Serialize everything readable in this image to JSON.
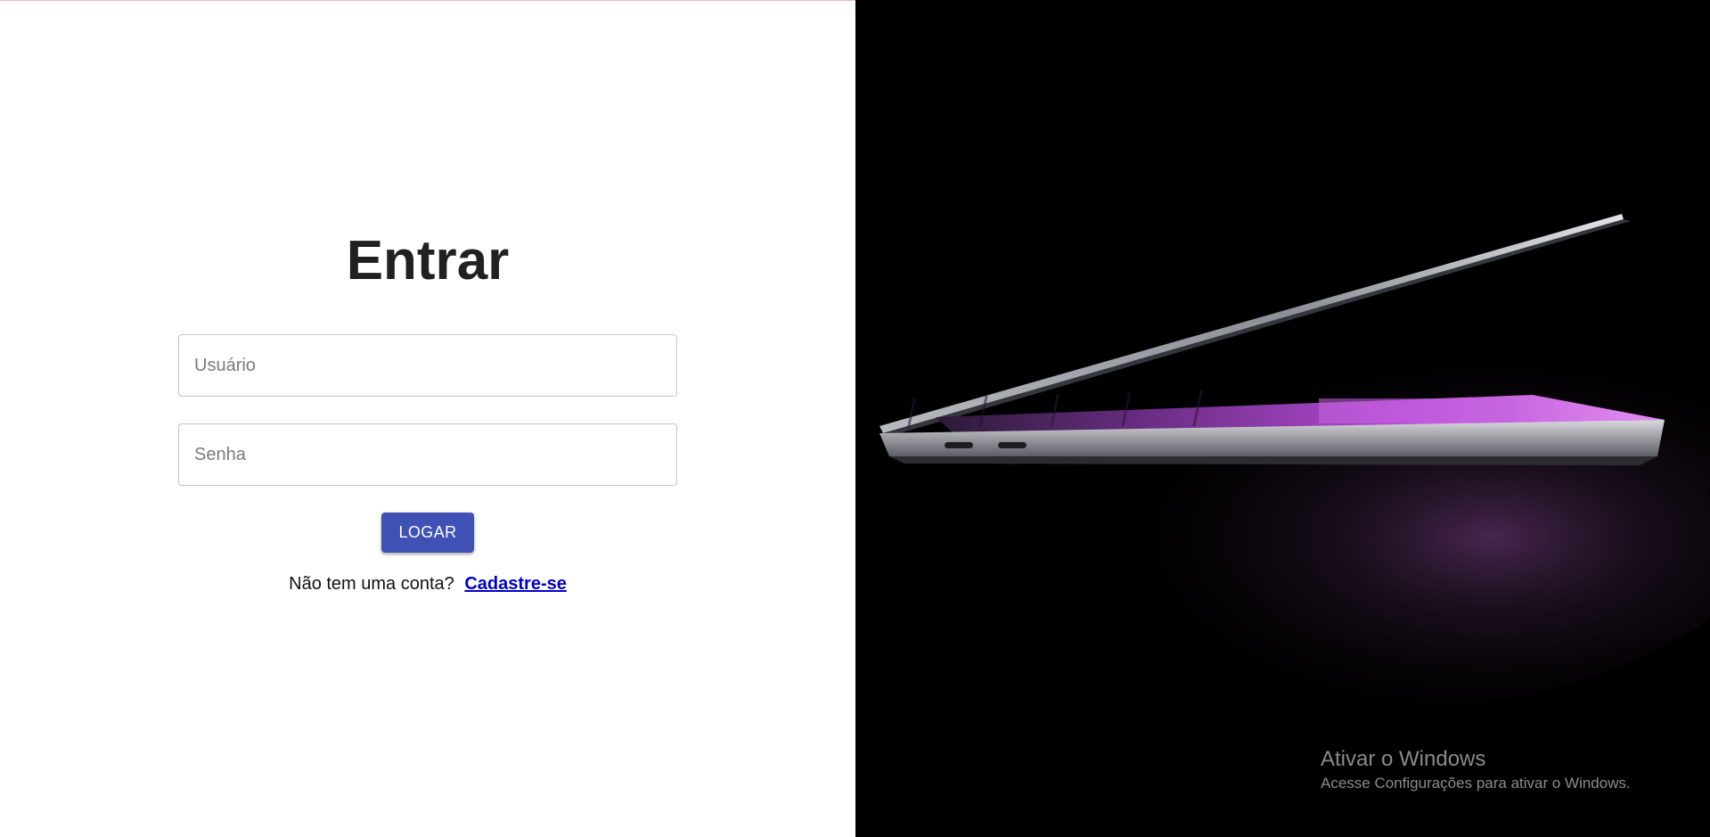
{
  "login": {
    "title": "Entrar",
    "username_placeholder": "Usuário",
    "password_placeholder": "Senha",
    "submit_label": "LOGAR",
    "signup_prompt": "Não tem uma conta?",
    "signup_link": "Cadastre-se"
  },
  "hero": {
    "image_subject": "laptop-image"
  },
  "windows_activation": {
    "title": "Ativar o Windows",
    "subtitle": "Acesse Configurações para ativar o Windows."
  },
  "colors": {
    "primary_button": "#3f51b5",
    "link": "#0000cc",
    "hero_background": "#000000",
    "hero_glow": "#b04bd6"
  }
}
